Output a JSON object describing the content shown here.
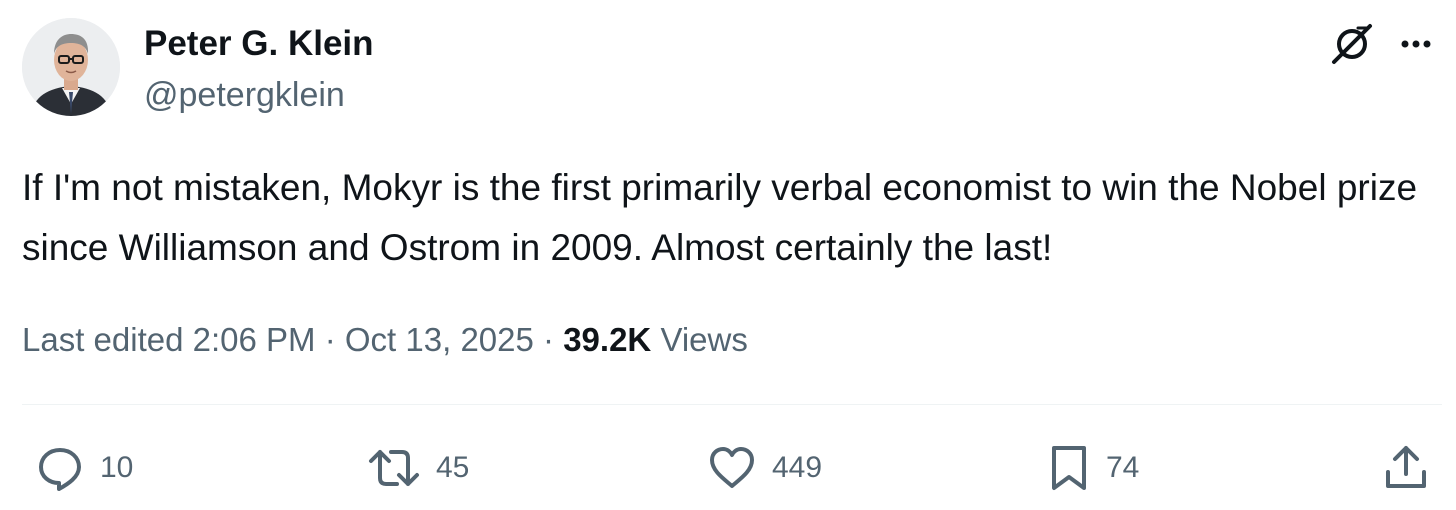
{
  "author": {
    "display_name": "Peter G. Klein",
    "handle": "@petergklein"
  },
  "tweet": {
    "text": "If I'm not mistaken, Mokyr is the first primarily verbal economist to win the Nobel prize since Williamson and Ostrom in 2009. Almost certainly the last!"
  },
  "meta": {
    "edited_prefix": "Last edited",
    "time": "2:06 PM",
    "separator": "·",
    "date": "Oct 13, 2025",
    "views_count": "39.2K",
    "views_label": "Views"
  },
  "actions": {
    "reply_count": "10",
    "repost_count": "45",
    "like_count": "449",
    "bookmark_count": "74"
  },
  "icons": {
    "grok": "grok-icon",
    "more": "more-icon",
    "reply": "reply-icon",
    "repost": "repost-icon",
    "like": "heart-icon",
    "bookmark": "bookmark-icon",
    "share": "share-icon"
  },
  "colors": {
    "text_primary": "#0f1419",
    "text_secondary": "#536471",
    "divider": "#eff3f4"
  }
}
